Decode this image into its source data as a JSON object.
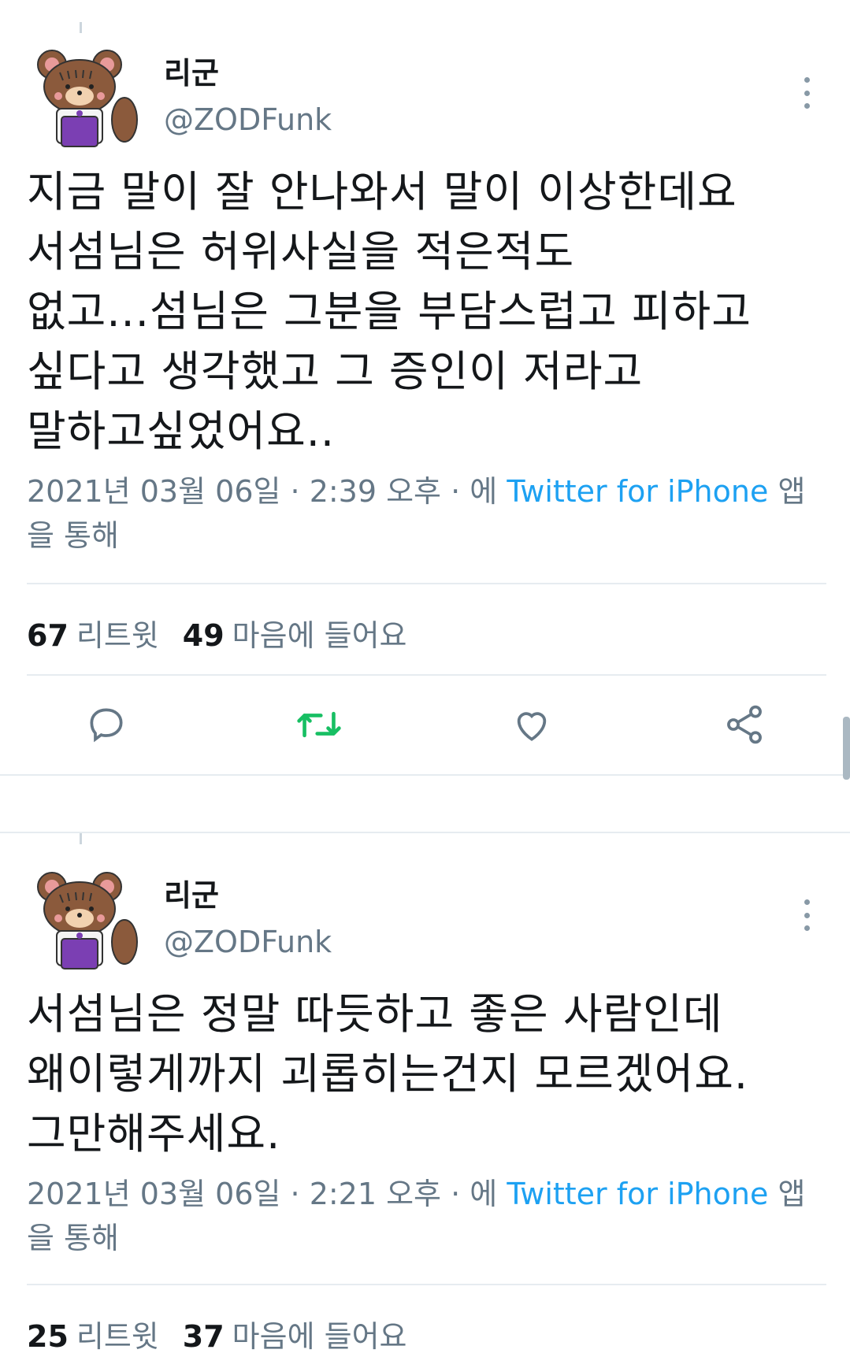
{
  "tweets": [
    {
      "author": {
        "name": "리군",
        "handle": "@ZODFunk"
      },
      "body_lines": [
        "지금 말이 잘 안나와서 말이 이상한데요",
        "서섬님은 허위사실을 적은적도",
        "없고...섬님은 그분을 부담스럽고 피하고",
        "싶다고 생각했고 그 증인이 저라고",
        "말하고싶었어요.."
      ],
      "meta": {
        "timestamp": "2021년 03월 06일 · 2:39 오후 · 에 ",
        "source": "Twitter for iPhone",
        "suffix": " 앱을 통해"
      },
      "stats": {
        "retweets": "67",
        "retweets_label": "리트윗",
        "likes": "49",
        "likes_label": "마음에 들어요"
      },
      "actions": [
        "reply-icon",
        "retweet-icon",
        "like-icon",
        "share-icon"
      ]
    },
    {
      "author": {
        "name": "리군",
        "handle": "@ZODFunk"
      },
      "body_lines": [
        "서섬님은 정말 따듯하고 좋은 사람인데",
        "왜이렇게까지 괴롭히는건지 모르겠어요.",
        "그만해주세요."
      ],
      "meta": {
        "timestamp": "2021년 03월 06일 · 2:21 오후 · 에 ",
        "source": "Twitter for iPhone",
        "suffix": " 앱을 통해"
      },
      "stats": {
        "retweets": "25",
        "retweets_label": "리트윗",
        "likes": "37",
        "likes_label": "마음에 들어요"
      }
    }
  ],
  "colors": {
    "text": "#14171a",
    "secondary": "#657786",
    "link": "#1da1f2",
    "retweet": "#17bf63",
    "divider": "#e6ecf0"
  }
}
